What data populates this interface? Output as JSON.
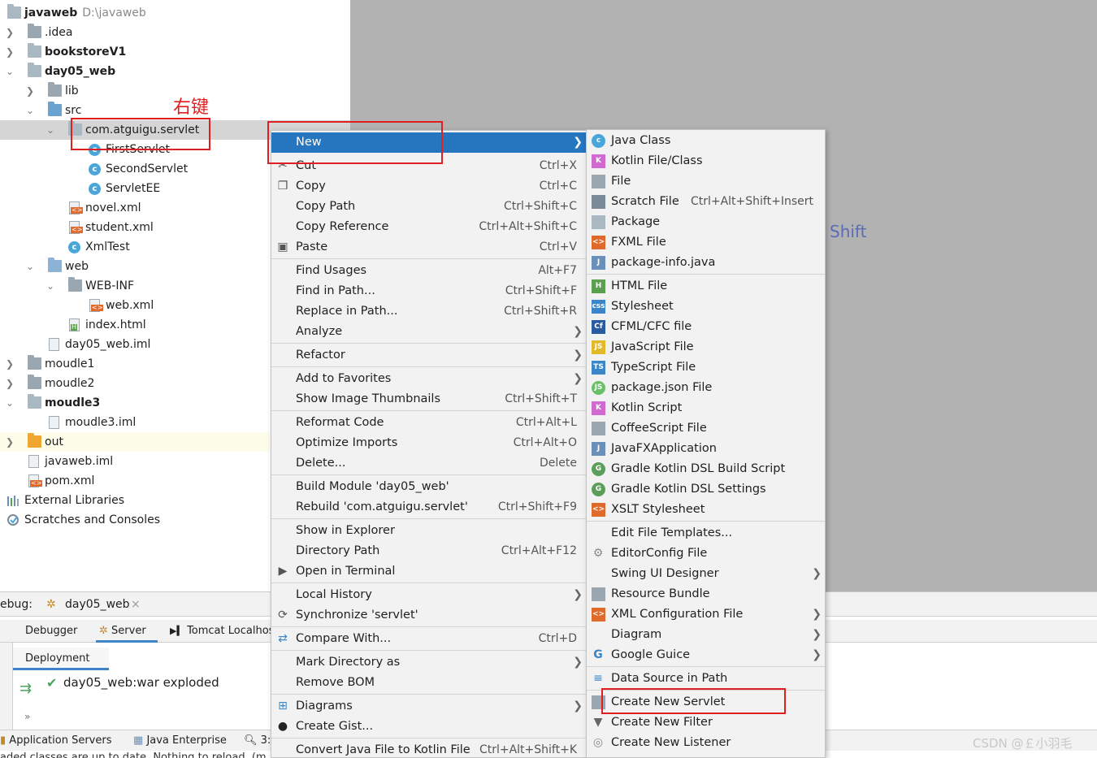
{
  "project_tree": {
    "root": {
      "name": "javaweb",
      "path": "D:\\javaweb"
    },
    "items": [
      {
        "label": ".idea"
      },
      {
        "label": "bookstoreV1"
      },
      {
        "label": "day05_web"
      },
      {
        "label": "lib"
      },
      {
        "label": "src"
      },
      {
        "label": "com.atguigu.servlet"
      },
      {
        "label": "FirstServlet"
      },
      {
        "label": "SecondServlet"
      },
      {
        "label": "ServletEE"
      },
      {
        "label": "novel.xml"
      },
      {
        "label": "student.xml"
      },
      {
        "label": "XmlTest"
      },
      {
        "label": "web"
      },
      {
        "label": "WEB-INF"
      },
      {
        "label": "web.xml"
      },
      {
        "label": "index.html"
      },
      {
        "label": "day05_web.iml"
      },
      {
        "label": "moudle1"
      },
      {
        "label": "moudle2"
      },
      {
        "label": "moudle3"
      },
      {
        "label": "moudle3.iml"
      },
      {
        "label": "out"
      },
      {
        "label": "javaweb.iml"
      },
      {
        "label": "pom.xml"
      },
      {
        "label": "External Libraries"
      },
      {
        "label": "Scratches and Consoles"
      }
    ]
  },
  "annotation": {
    "right_click_text": "右键"
  },
  "editor": {
    "hint": "Shift"
  },
  "debug": {
    "title_prefix": "ebug:",
    "config_name": "day05_web",
    "close_glyph": "×",
    "tabs": [
      "Debugger",
      "Server",
      "Tomcat Localhos"
    ],
    "deployment_tab": "Deployment",
    "artifact": "day05_web:war exploded",
    "bottom_tabs": [
      "Application Servers",
      "Java Enterprise",
      "3:"
    ],
    "status": "aded classes are up to date. Nothing to reload. (m"
  },
  "context_menu": {
    "items": [
      {
        "label": "New",
        "shortcut": "",
        "submenu": true
      },
      {
        "label": "Cut",
        "shortcut": "Ctrl+X"
      },
      {
        "label": "Copy",
        "shortcut": "Ctrl+C"
      },
      {
        "label": "Copy Path",
        "shortcut": "Ctrl+Shift+C"
      },
      {
        "label": "Copy Reference",
        "shortcut": "Ctrl+Alt+Shift+C"
      },
      {
        "label": "Paste",
        "shortcut": "Ctrl+V"
      },
      {
        "label": "Find Usages",
        "shortcut": "Alt+F7"
      },
      {
        "label": "Find in Path...",
        "shortcut": "Ctrl+Shift+F"
      },
      {
        "label": "Replace in Path...",
        "shortcut": "Ctrl+Shift+R"
      },
      {
        "label": "Analyze",
        "shortcut": "",
        "submenu": true
      },
      {
        "label": "Refactor",
        "shortcut": "",
        "submenu": true
      },
      {
        "label": "Add to Favorites",
        "shortcut": "",
        "submenu": true
      },
      {
        "label": "Show Image Thumbnails",
        "shortcut": "Ctrl+Shift+T"
      },
      {
        "label": "Reformat Code",
        "shortcut": "Ctrl+Alt+L"
      },
      {
        "label": "Optimize Imports",
        "shortcut": "Ctrl+Alt+O"
      },
      {
        "label": "Delete...",
        "shortcut": "Delete"
      },
      {
        "label": "Build Module 'day05_web'",
        "shortcut": ""
      },
      {
        "label": "Rebuild 'com.atguigu.servlet'",
        "shortcut": "Ctrl+Shift+F9"
      },
      {
        "label": "Show in Explorer",
        "shortcut": ""
      },
      {
        "label": "Directory Path",
        "shortcut": "Ctrl+Alt+F12"
      },
      {
        "label": "Open in Terminal",
        "shortcut": ""
      },
      {
        "label": "Local History",
        "shortcut": "",
        "submenu": true
      },
      {
        "label": "Synchronize 'servlet'",
        "shortcut": ""
      },
      {
        "label": "Compare With...",
        "shortcut": "Ctrl+D"
      },
      {
        "label": "Mark Directory as",
        "shortcut": "",
        "submenu": true
      },
      {
        "label": "Remove BOM",
        "shortcut": ""
      },
      {
        "label": "Diagrams",
        "shortcut": "",
        "submenu": true
      },
      {
        "label": "Create Gist...",
        "shortcut": ""
      },
      {
        "label": "Convert Java File to Kotlin File",
        "shortcut": "Ctrl+Alt+Shift+K"
      }
    ]
  },
  "new_submenu": {
    "items": [
      {
        "label": "Java Class",
        "shortcut": ""
      },
      {
        "label": "Kotlin File/Class",
        "shortcut": ""
      },
      {
        "label": "File",
        "shortcut": ""
      },
      {
        "label": "Scratch File",
        "shortcut": "Ctrl+Alt+Shift+Insert"
      },
      {
        "label": "Package",
        "shortcut": ""
      },
      {
        "label": "FXML File",
        "shortcut": ""
      },
      {
        "label": "package-info.java",
        "shortcut": ""
      },
      {
        "label": "HTML File",
        "shortcut": ""
      },
      {
        "label": "Stylesheet",
        "shortcut": ""
      },
      {
        "label": "CFML/CFC file",
        "shortcut": ""
      },
      {
        "label": "JavaScript File",
        "shortcut": ""
      },
      {
        "label": "TypeScript File",
        "shortcut": ""
      },
      {
        "label": "package.json File",
        "shortcut": ""
      },
      {
        "label": "Kotlin Script",
        "shortcut": ""
      },
      {
        "label": "CoffeeScript File",
        "shortcut": ""
      },
      {
        "label": "JavaFXApplication",
        "shortcut": ""
      },
      {
        "label": "Gradle Kotlin DSL Build Script",
        "shortcut": ""
      },
      {
        "label": "Gradle Kotlin DSL Settings",
        "shortcut": ""
      },
      {
        "label": "XSLT Stylesheet",
        "shortcut": ""
      },
      {
        "label": "Edit File Templates...",
        "shortcut": ""
      },
      {
        "label": "EditorConfig File",
        "shortcut": ""
      },
      {
        "label": "Swing UI Designer",
        "shortcut": "",
        "submenu": true
      },
      {
        "label": "Resource Bundle",
        "shortcut": ""
      },
      {
        "label": "XML Configuration File",
        "shortcut": "",
        "submenu": true
      },
      {
        "label": "Diagram",
        "shortcut": "",
        "submenu": true
      },
      {
        "label": "Google Guice",
        "shortcut": "",
        "submenu": true
      },
      {
        "label": "Data Source in Path",
        "shortcut": ""
      },
      {
        "label": "Create New Servlet",
        "shortcut": ""
      },
      {
        "label": "Create New Filter",
        "shortcut": ""
      },
      {
        "label": "Create New Listener",
        "shortcut": ""
      }
    ]
  },
  "watermark": "CSDN @￡小羽毛",
  "colors": {
    "selection": "#2675bf",
    "annotation_red": "#e02020",
    "editor_bg": "#b2b2b2"
  }
}
